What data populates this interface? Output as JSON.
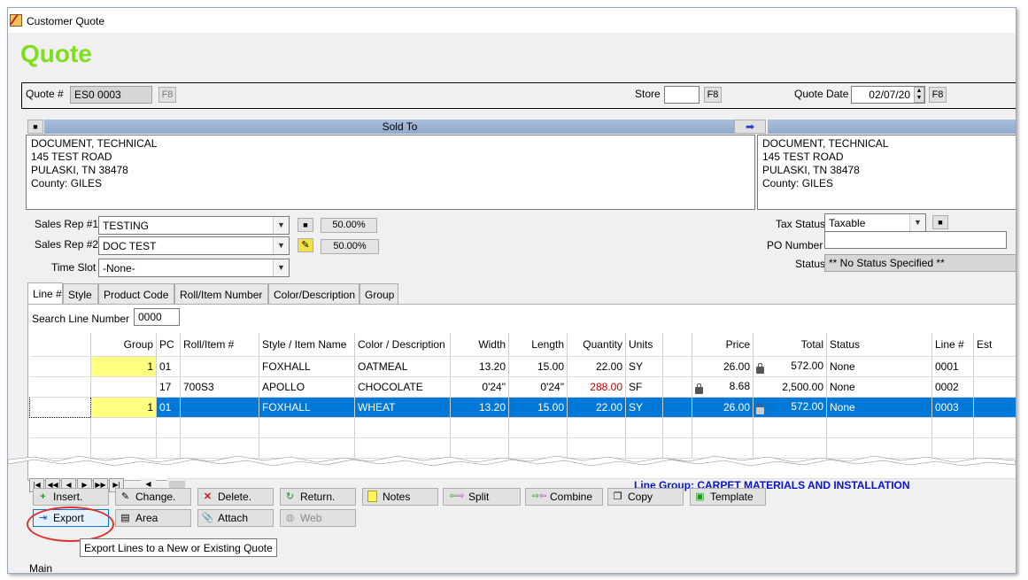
{
  "window": {
    "title": "Customer Quote"
  },
  "heading": "Quote",
  "top": {
    "quote_label": "Quote #",
    "quote_value": "ES0 0003",
    "f8": "F8",
    "store_label": "Store",
    "store_value": "",
    "quote_date_label": "Quote Date",
    "quote_date_value": "02/07/20"
  },
  "sold_to": {
    "header": "Sold To",
    "lines": [
      "DOCUMENT, TECHNICAL",
      "145 TEST ROAD",
      "PULASKI, TN  38478",
      "County: GILES"
    ]
  },
  "ship_to": {
    "lines": [
      "DOCUMENT, TECHNICAL",
      "145 TEST ROAD",
      "PULASKI, TN  38478",
      "County: GILES"
    ]
  },
  "sales": {
    "rep1_label": "Sales Rep #1",
    "rep1_value": "TESTING",
    "rep1_pct": "50.00%",
    "rep2_label": "Sales Rep #2",
    "rep2_value": "DOC TEST",
    "rep2_pct": "50.00%",
    "timeslot_label": "Time Slot",
    "timeslot_value": "-None-"
  },
  "right_fields": {
    "tax_status_label": "Tax Status",
    "tax_status_value": "Taxable",
    "po_number_label": "PO Number",
    "po_number_value": "",
    "status_label": "Status",
    "status_value": "** No Status Specified **"
  },
  "tabs": [
    "Line #",
    "Style",
    "Product Code",
    "Roll/Item Number",
    "Color/Description",
    "Group"
  ],
  "search": {
    "label": "Search Line Number",
    "value": "0000"
  },
  "grid": {
    "headers": [
      "",
      "Group",
      "PC",
      "Roll/Item #",
      "Style / Item Name",
      "Color / Description",
      "Width",
      "Length",
      "Quantity",
      "Units",
      "",
      "Price",
      "Total",
      "Status",
      "Line #",
      "Est"
    ],
    "rows": [
      [
        "",
        "1",
        "01",
        "",
        "FOXHALL",
        "OATMEAL",
        "13.20",
        "15.00",
        "22.00",
        "SY",
        "",
        "26.00",
        "572.00",
        "None",
        "0001",
        ""
      ],
      [
        "",
        "",
        "17",
        "700S3",
        "APOLLO",
        "CHOCOLATE",
        "0'24\"",
        "0'24\"",
        "288.00",
        "SF",
        "",
        "8.68",
        "2,500.00",
        "None",
        "0002",
        ""
      ],
      [
        "",
        "1",
        "01",
        "",
        "FOXHALL",
        "WHEAT",
        "13.20",
        "15.00",
        "22.00",
        "SY",
        "",
        "26.00",
        "572.00",
        "None",
        "0003",
        ""
      ]
    ]
  },
  "line_group": "Line Group: CARPET MATERIALS AND INSTALLATION",
  "actions": {
    "insert": "Insert",
    "change": "Change",
    "delete": "Delete",
    "return": "Return",
    "notes": "Notes",
    "split": "Split",
    "combine": "Combine",
    "copy": "Copy",
    "template": "Template",
    "export": "Export",
    "area": "Area",
    "attach": "Attach",
    "web": "Web"
  },
  "tooltip": "Export Lines to a New or Existing Quote",
  "bottom_label": "Main",
  "colors": {
    "selection": "#0078d7",
    "heading": "#7ee01c",
    "line_group": "#0a14c8",
    "highlight_circle": "#e0302a"
  }
}
